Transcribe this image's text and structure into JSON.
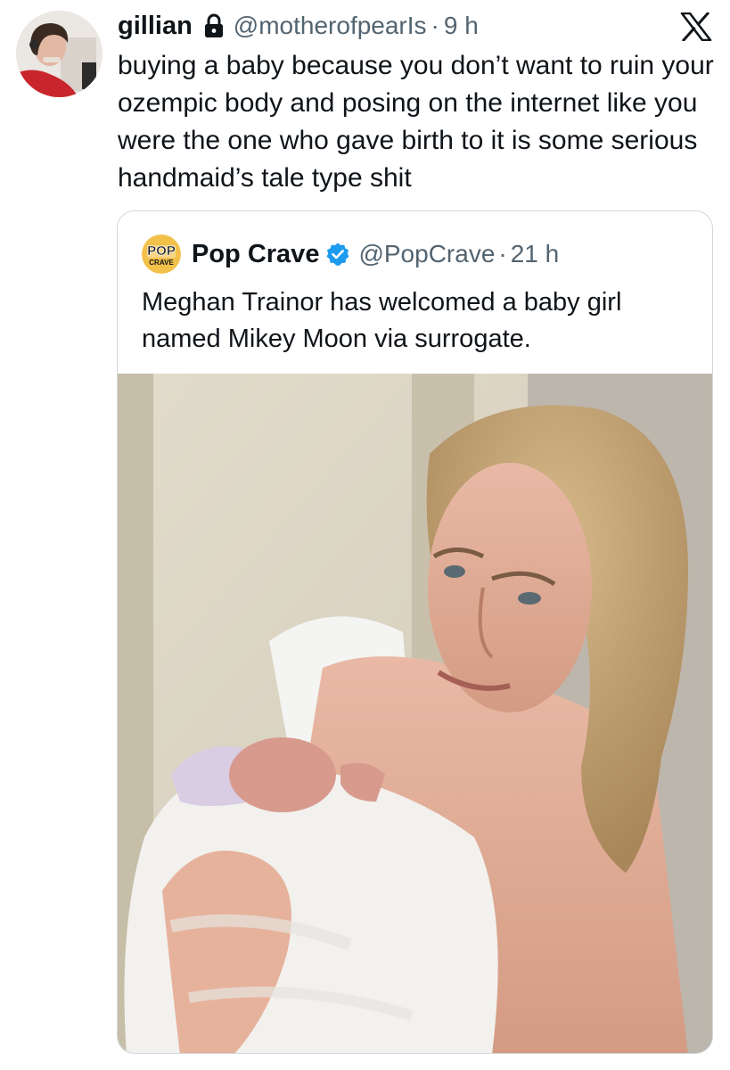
{
  "tweet": {
    "author": {
      "display_name": "gillian",
      "handle": "@motherofpearIs",
      "protected_icon": "lock-icon",
      "avatar": "user-avatar"
    },
    "separator": "·",
    "time": "9 h",
    "brand_icon": "x-logo-icon",
    "text": "buying a baby because you don’t want to ruin your ozempic body and posing on the internet like you were the one who gave birth to it is some serious handmaid’s tale type shit"
  },
  "quote": {
    "author": {
      "display_name": "Pop Crave",
      "handle": "@PopCrave",
      "verified_icon": "verified-badge-icon",
      "avatar": "pop-crave-logo"
    },
    "separator": "·",
    "time": "21 h",
    "text": "Meghan Trainor has welcomed a baby girl named Mikey Moon via surrogate.",
    "media": "photo"
  },
  "colors": {
    "text_primary": "#0f1419",
    "text_secondary": "#536471",
    "border": "#cfd9de",
    "verified_blue": "#1d9bf0"
  }
}
